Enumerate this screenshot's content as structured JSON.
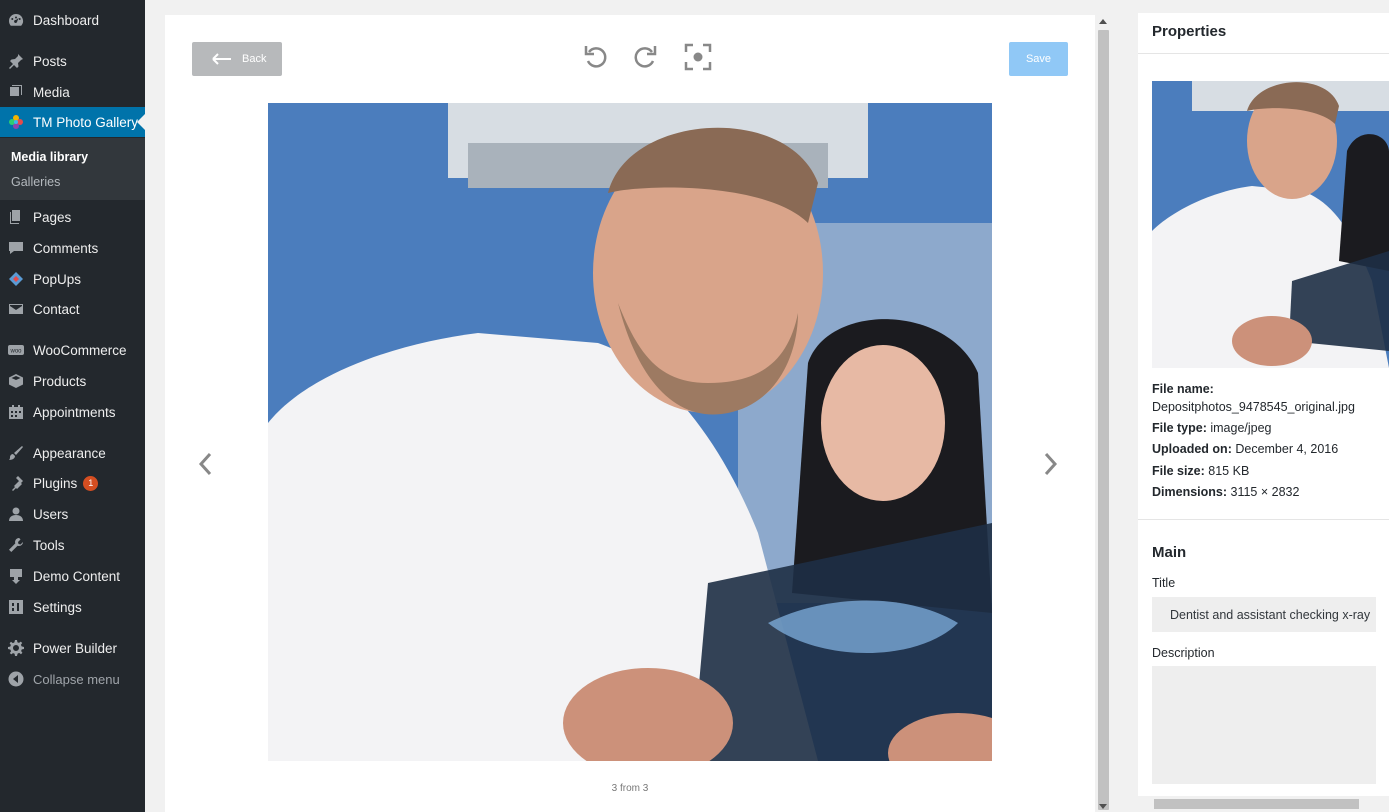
{
  "sidebar": {
    "items": [
      {
        "label": "Dashboard",
        "icon": "dashboard-icon"
      },
      {
        "label": "Posts",
        "icon": "pin-icon"
      },
      {
        "label": "Media",
        "icon": "media-icon"
      },
      {
        "label": "TM Photo Gallery",
        "icon": "flower-icon"
      },
      {
        "label": "Pages",
        "icon": "pages-icon"
      },
      {
        "label": "Comments",
        "icon": "comment-icon"
      },
      {
        "label": "PopUps",
        "icon": "popups-icon"
      },
      {
        "label": "Contact",
        "icon": "mail-icon"
      },
      {
        "label": "WooCommerce",
        "icon": "woo-icon"
      },
      {
        "label": "Products",
        "icon": "box-icon"
      },
      {
        "label": "Appointments",
        "icon": "calendar-icon"
      },
      {
        "label": "Appearance",
        "icon": "brush-icon"
      },
      {
        "label": "Plugins",
        "icon": "plugin-icon",
        "badge": "1"
      },
      {
        "label": "Users",
        "icon": "user-icon"
      },
      {
        "label": "Tools",
        "icon": "wrench-icon"
      },
      {
        "label": "Demo Content",
        "icon": "download-icon"
      },
      {
        "label": "Settings",
        "icon": "settings-icon"
      },
      {
        "label": "Power Builder",
        "icon": "gear-icon"
      }
    ],
    "submenu": [
      "Media library",
      "Galleries"
    ],
    "collapse_label": "Collapse menu",
    "accent_color": "#0073aa"
  },
  "editor": {
    "back_label": "Back",
    "save_label": "Save",
    "tools": [
      "rotate-left-icon",
      "rotate-right-icon",
      "focus-icon"
    ],
    "pager": "3 from 3"
  },
  "properties": {
    "header": "Properties",
    "file_name_label": "File name:",
    "file_name": "Depositphotos_9478545_original.jpg",
    "file_type_label": "File type:",
    "file_type": "image/jpeg",
    "uploaded_label": "Uploaded on:",
    "uploaded": "December 4, 2016",
    "size_label": "File size:",
    "size": "815 KB",
    "dimensions_label": "Dimensions:",
    "dimensions": "3115 × 2832",
    "main_header": "Main",
    "title_label": "Title",
    "title_value": "Dentist and assistant checking x-ray",
    "description_label": "Description"
  }
}
